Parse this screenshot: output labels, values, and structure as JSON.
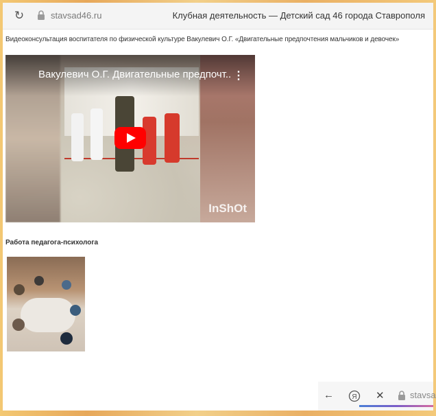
{
  "browser": {
    "url": "stavsad46.ru",
    "tab_title": "Клубная деятельность — Детский сад 46 города Ставрополя",
    "reload_icon": "reload-icon",
    "lock_icon": "lock-icon"
  },
  "content": {
    "caption": "Видеоконсультация воспитателя по физической культуре Вакулевич О.Г. «Двигательные предпочтения мальчиков и девочек»",
    "video": {
      "title": "Вакулевич О.Г. Двигательные предпочт...",
      "menu_icon": "more-vert-icon",
      "play_icon": "play-icon",
      "watermark": "InShOt"
    },
    "section_title": "Работа педагога-психолога"
  },
  "bottom_bar": {
    "back_icon": "back-arrow-icon",
    "yandex_icon": "yandex-icon",
    "close_icon": "close-icon",
    "url": "stavsa"
  },
  "colors": {
    "play_button": "#ff0000",
    "frame": "#e9b86a"
  }
}
